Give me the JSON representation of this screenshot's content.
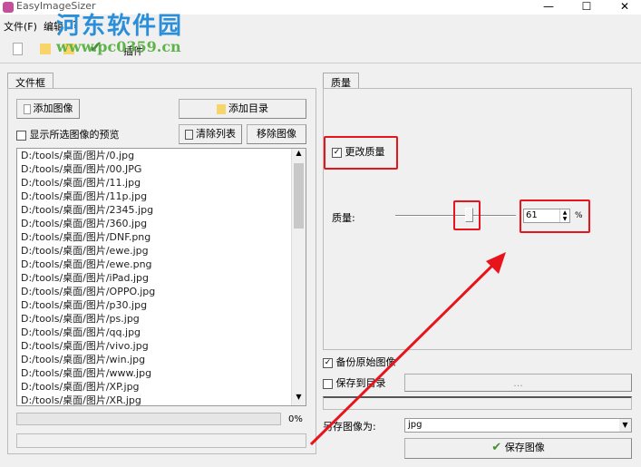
{
  "window": {
    "title": "EasyImageSizer",
    "minimize": "—",
    "maximize": "☐",
    "close": "✕"
  },
  "watermark": {
    "name": "河东软件园",
    "url": "www.pc0359.cn"
  },
  "menu": [
    "文件(F)",
    "编辑",
    "?"
  ],
  "toolbar": {
    "plugin": "插件"
  },
  "left": {
    "tab": "文件框",
    "add_image": "添加图像",
    "add_folder": "添加目录",
    "show_preview": "显示所选图像的预览",
    "clear_list": "清除列表",
    "remove_image": "移除图像",
    "files": [
      "D:/tools/桌面/图片/0.jpg",
      "D:/tools/桌面/图片/00.JPG",
      "D:/tools/桌面/图片/11.jpg",
      "D:/tools/桌面/图片/11p.jpg",
      "D:/tools/桌面/图片/2345.jpg",
      "D:/tools/桌面/图片/360.jpg",
      "D:/tools/桌面/图片/DNF.png",
      "D:/tools/桌面/图片/ewe.jpg",
      "D:/tools/桌面/图片/ewe.png",
      "D:/tools/桌面/图片/iPad.jpg",
      "D:/tools/桌面/图片/OPPO.jpg",
      "D:/tools/桌面/图片/p30.jpg",
      "D:/tools/桌面/图片/ps.jpg",
      "D:/tools/桌面/图片/qq.jpg",
      "D:/tools/桌面/图片/vivo.jpg",
      "D:/tools/桌面/图片/win.jpg",
      "D:/tools/桌面/图片/www.jpg",
      "D:/tools/桌面/图片/XP.jpg",
      "D:/tools/桌面/图片/XR.jpg"
    ],
    "progress_text": "0%",
    "progress": 0
  },
  "right": {
    "tab": "质量",
    "change_quality": "更改质量",
    "quality_label": "质量:",
    "quality_value": "61",
    "percent": "%",
    "quality_fraction": 0.61,
    "backup": "备份原始图像",
    "save_to_dir": "保存到目录",
    "browse": "...",
    "save_as_label": "另存图像为:",
    "format": "jpg",
    "save_button": "保存图像"
  }
}
